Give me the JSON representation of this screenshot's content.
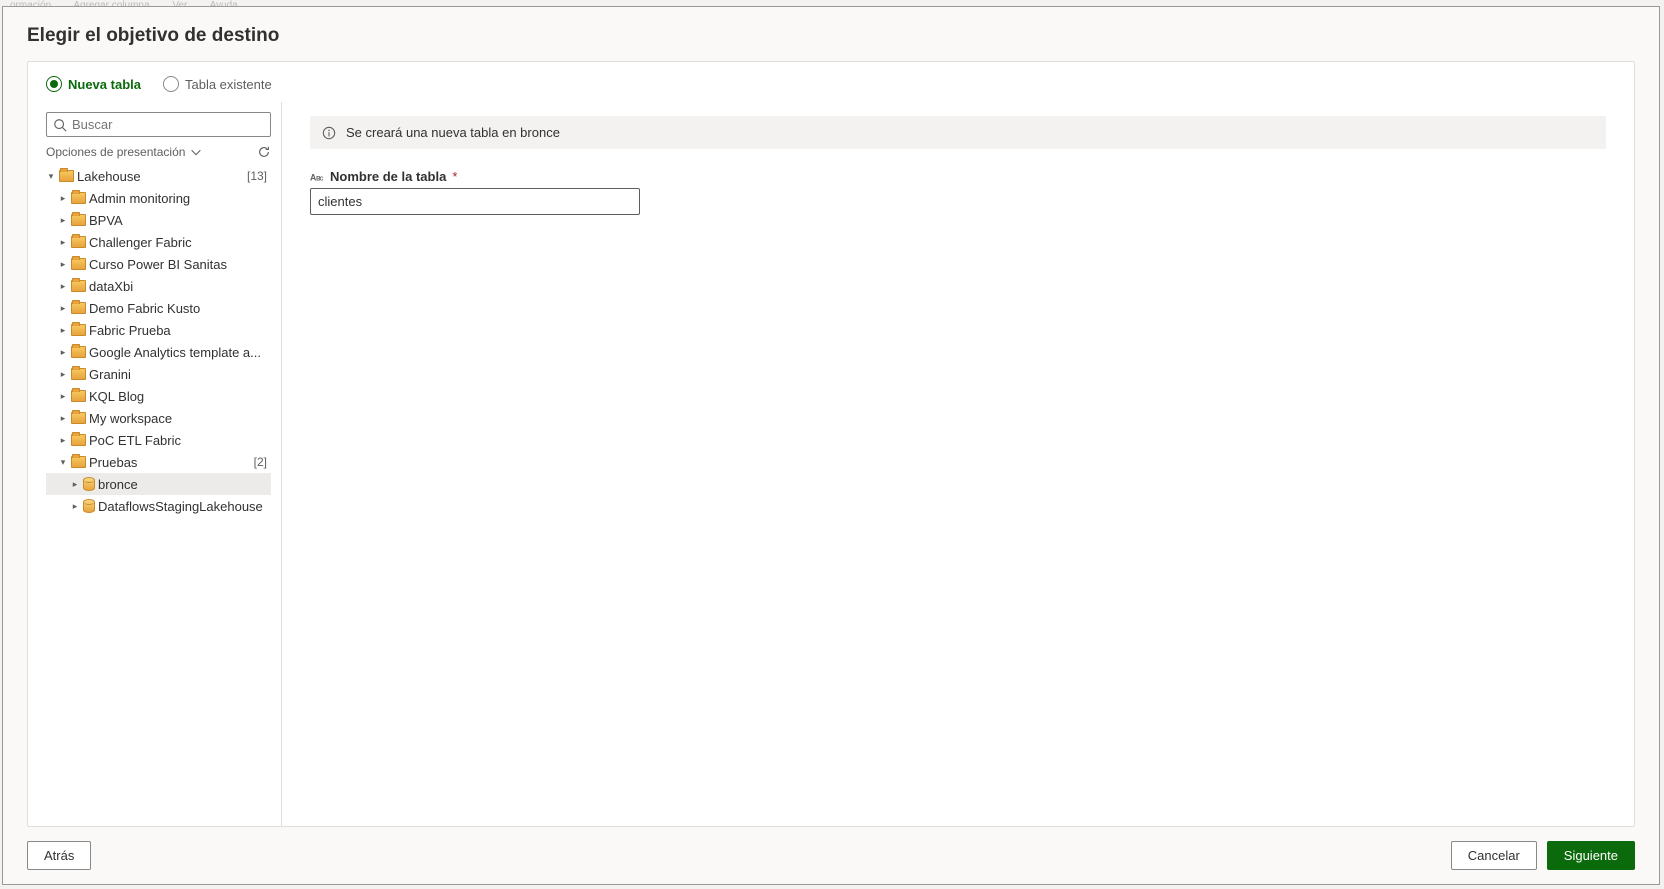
{
  "bg_menu": [
    "ormación",
    "Agregar columna",
    "Ver",
    "Ayuda"
  ],
  "title": "Elegir el objetivo de destino",
  "radios": {
    "new_table": "Nueva tabla",
    "existing_table": "Tabla existente"
  },
  "search": {
    "placeholder": "Buscar"
  },
  "options_label": "Opciones de presentación",
  "tree": {
    "root": {
      "label": "Lakehouse",
      "count": "[13]"
    },
    "items": [
      {
        "label": "Admin monitoring"
      },
      {
        "label": "BPVA"
      },
      {
        "label": "Challenger Fabric"
      },
      {
        "label": "Curso Power BI Sanitas"
      },
      {
        "label": "dataXbi"
      },
      {
        "label": "Demo Fabric Kusto"
      },
      {
        "label": "Fabric Prueba"
      },
      {
        "label": "Google Analytics template a..."
      },
      {
        "label": "Granini"
      },
      {
        "label": "KQL Blog"
      },
      {
        "label": "My workspace"
      },
      {
        "label": "PoC ETL Fabric"
      }
    ],
    "pruebas": {
      "label": "Pruebas",
      "count": "[2]"
    },
    "pruebas_children": [
      {
        "label": "bronce",
        "icon": "db",
        "selected": true
      },
      {
        "label": "DataflowsStagingLakehouse",
        "icon": "db"
      }
    ]
  },
  "info_message": "Se creará una nueva tabla en bronce",
  "field": {
    "label": "Nombre de la tabla",
    "value": "clientes"
  },
  "buttons": {
    "back": "Atrás",
    "cancel": "Cancelar",
    "next": "Siguiente"
  }
}
